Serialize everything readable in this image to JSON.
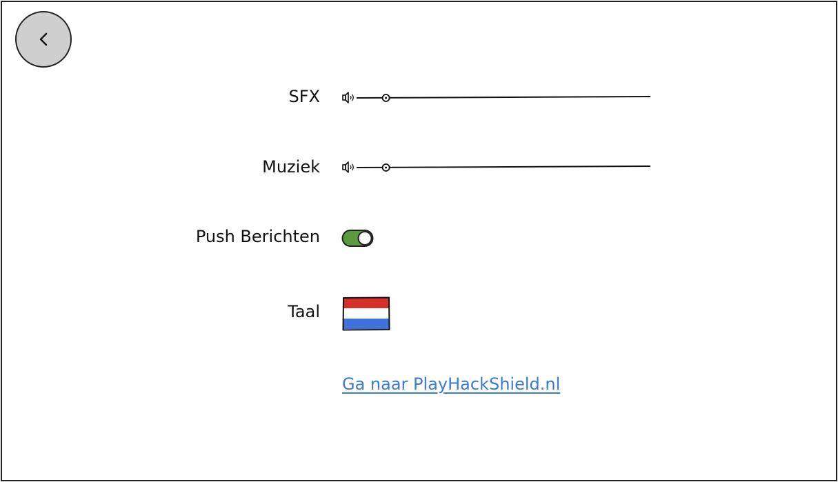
{
  "back_button": {
    "icon": "chevron-left-icon"
  },
  "settings": {
    "sfx": {
      "label": "SFX",
      "icon": "speaker-icon",
      "level": 0.1
    },
    "music": {
      "label": "Muziek",
      "icon": "speaker-icon",
      "level": 0.1
    },
    "push": {
      "label": "Push Berichten",
      "enabled": true,
      "on_color": "#5b9a3e"
    },
    "language": {
      "label": "Taal",
      "icon": "flag-nl-icon",
      "colors": [
        "#d6302b",
        "#ffffff",
        "#3f72d9"
      ]
    }
  },
  "link": {
    "text": "Ga naar PlayHackShield.nl",
    "color": "#3a7bd5"
  }
}
